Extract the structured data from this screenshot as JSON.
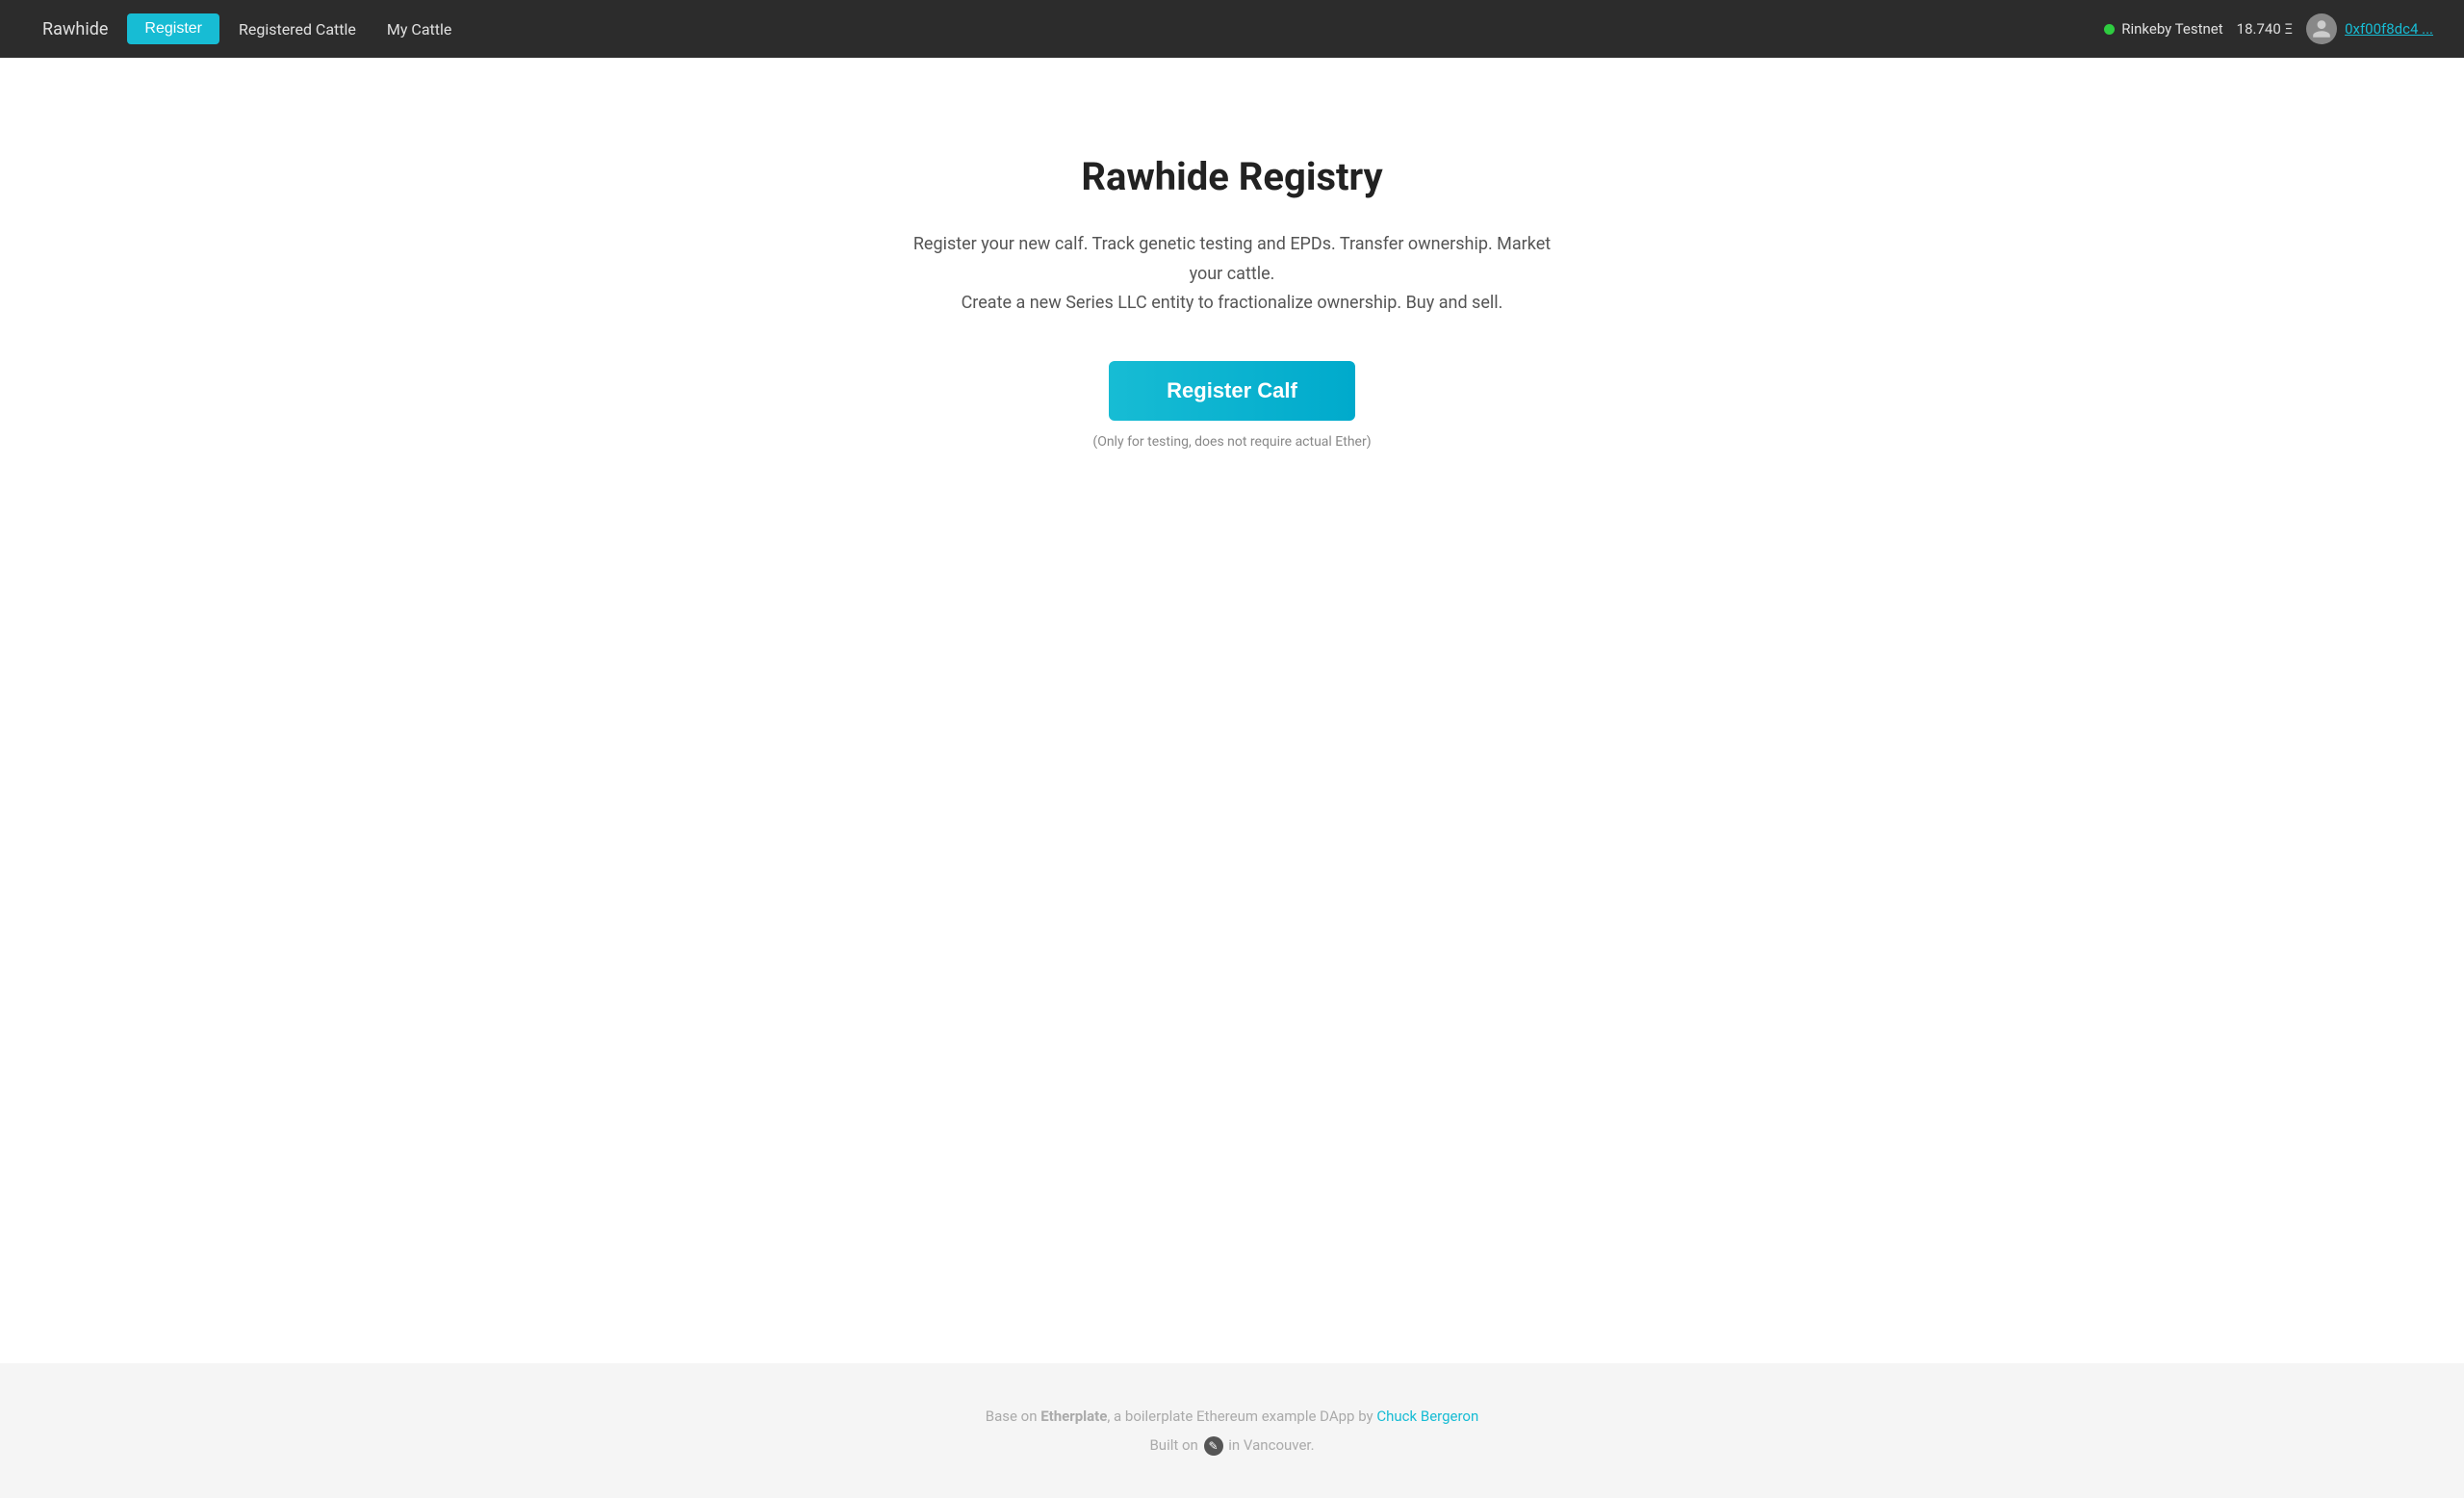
{
  "nav": {
    "brand": "Rawhide",
    "register_label": "Register",
    "registered_cattle_label": "Registered Cattle",
    "my_cattle_label": "My Cattle",
    "network_name": "Rinkeby Testnet",
    "eth_balance": "18.740 Ξ",
    "account_address": "0xf00f8dc4 ..."
  },
  "main": {
    "title": "Rawhide Registry",
    "description_line1": "Register your new calf. Track genetic testing and EPDs. Transfer ownership. Market your cattle.",
    "description_line2": "Create a new Series LLC entity to fractionalize ownership. Buy and sell.",
    "register_calf_button": "Register Calf",
    "testing_note": "(Only for testing, does not require actual Ether)"
  },
  "footer": {
    "base_text": "Base on ",
    "etherplate": "Etherplate",
    "boilerplate_text": ", a boilerplate Ethereum example DApp by ",
    "author": "Chuck Bergeron",
    "built_on_text": "Built on ",
    "built_in_text": " in Vancouver."
  }
}
